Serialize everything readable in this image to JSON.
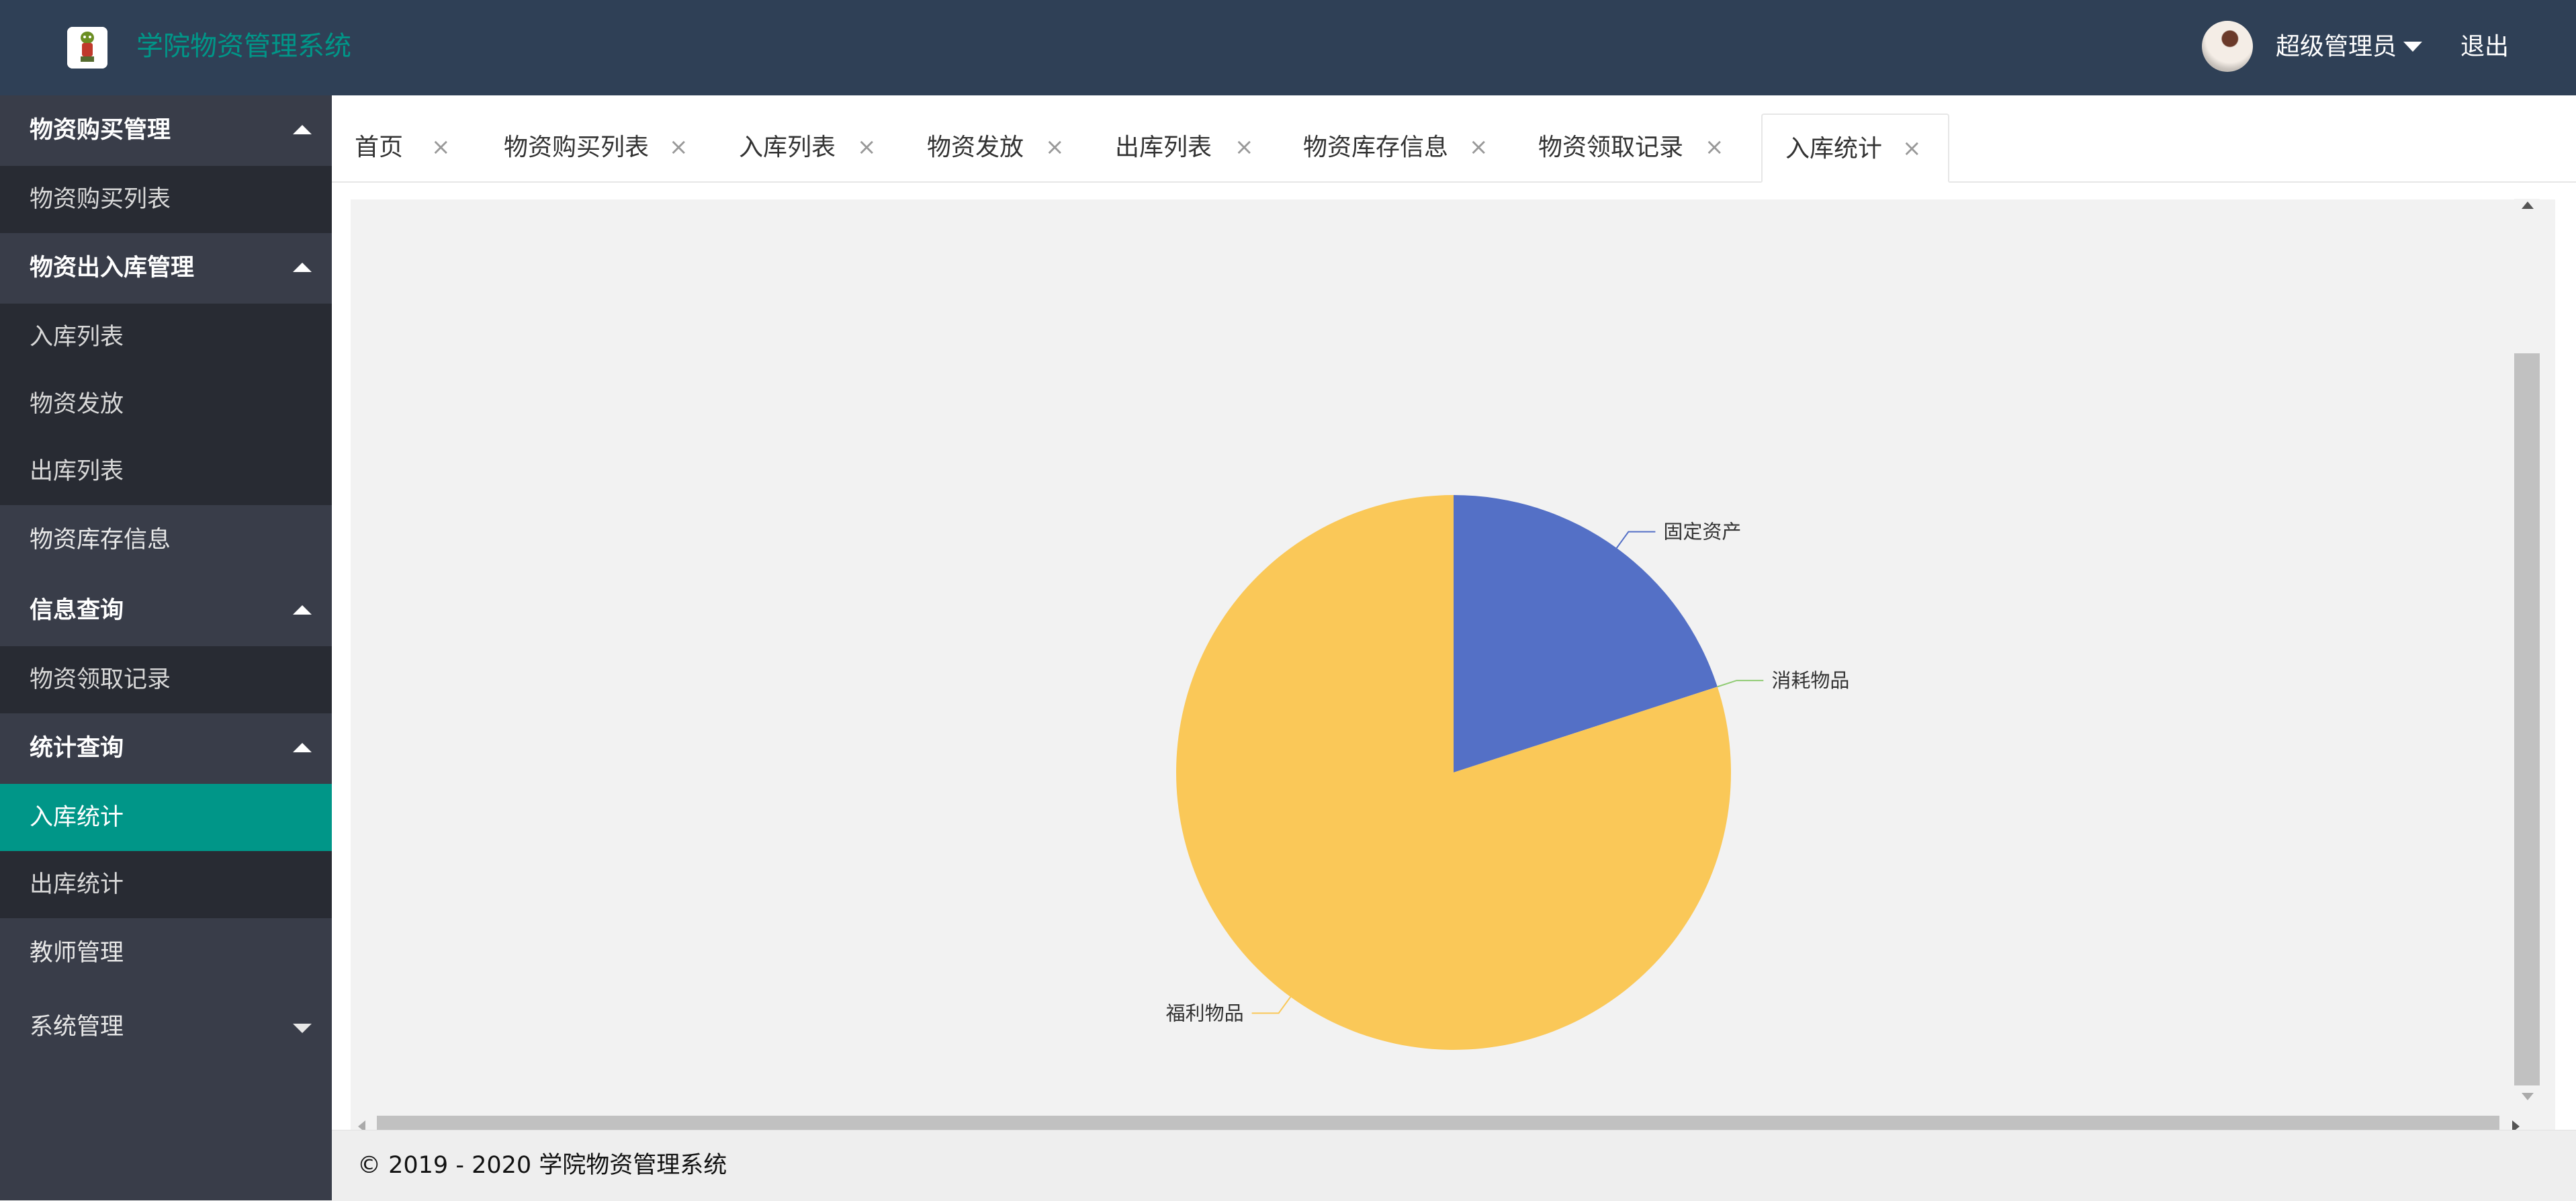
{
  "header": {
    "app_title": "学院物资管理系统",
    "user_name": "超级管理员",
    "logout": "退出",
    "accent_color": "#009688",
    "bg_color": "#2f4056"
  },
  "sidebar": {
    "groups": [
      {
        "label": "物资购买管理",
        "expanded": true,
        "children": [
          {
            "label": "物资购买列表"
          }
        ]
      },
      {
        "label": "物资出入库管理",
        "expanded": true,
        "children": [
          {
            "label": "入库列表"
          },
          {
            "label": "物资发放"
          },
          {
            "label": "出库列表"
          }
        ]
      },
      {
        "label": "物资库存信息"
      },
      {
        "label": "信息查询",
        "expanded": true,
        "children": [
          {
            "label": "物资领取记录"
          }
        ]
      },
      {
        "label": "统计查询",
        "expanded": true,
        "children": [
          {
            "label": "入库统计",
            "active": true
          },
          {
            "label": "出库统计"
          }
        ]
      },
      {
        "label": "教师管理"
      },
      {
        "label": "系统管理",
        "expanded": false
      }
    ]
  },
  "tabs": [
    {
      "label": "首页",
      "close": "×"
    },
    {
      "label": "物资购买列表",
      "close": "×"
    },
    {
      "label": "入库列表",
      "close": "×"
    },
    {
      "label": "物资发放",
      "close": "×"
    },
    {
      "label": "出库列表",
      "close": "×"
    },
    {
      "label": "物资库存信息",
      "close": "×"
    },
    {
      "label": "物资领取记录",
      "close": "×"
    },
    {
      "label": "入库统计",
      "close": "×",
      "active": true
    }
  ],
  "chart_data": {
    "type": "pie",
    "title": "",
    "categories": [
      "固定资产",
      "消耗物品",
      "福利物品"
    ],
    "values": [
      20,
      0,
      80
    ],
    "colors": [
      "#5470c6",
      "#91cc75",
      "#fac858"
    ],
    "legend": "none"
  },
  "footer": {
    "copyright": "© 2019 - 2020 学院物资管理系统"
  }
}
